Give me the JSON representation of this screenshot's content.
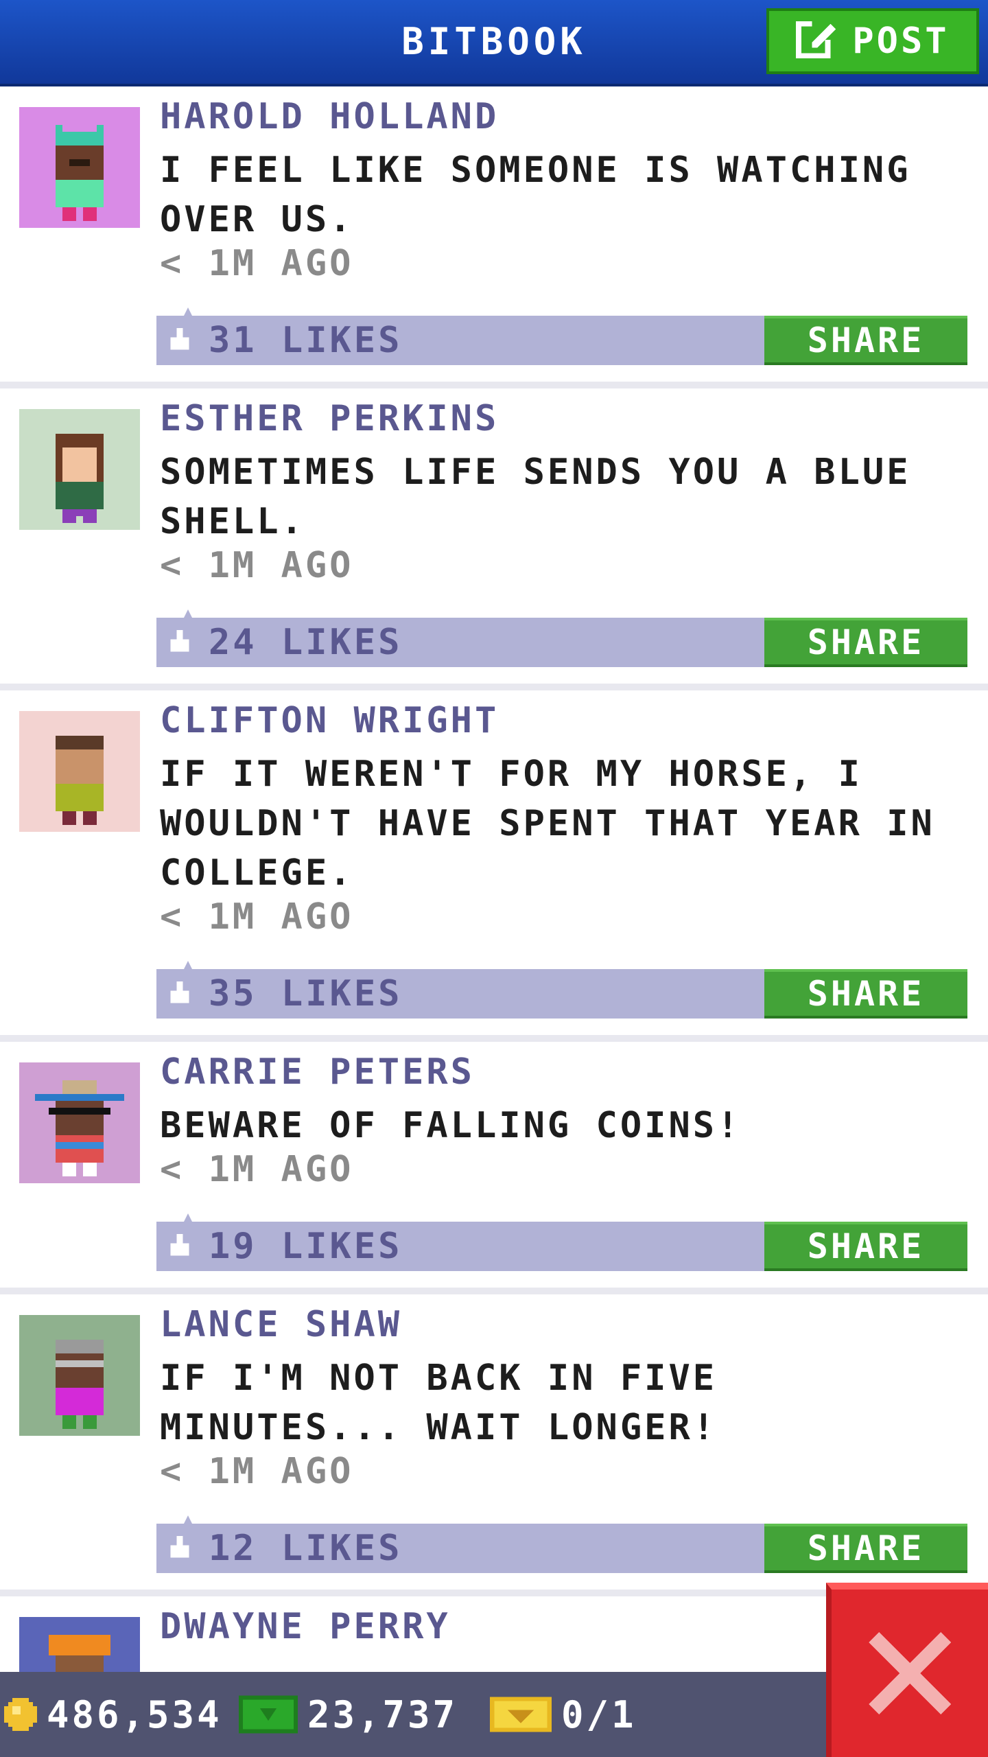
{
  "header": {
    "title": "BITBOOK",
    "post_label": "POST"
  },
  "posts": [
    {
      "name": "HAROLD HOLLAND",
      "text": "I FEEL LIKE SOMEONE IS WATCHING OVER US.",
      "time": "< 1M AGO",
      "likes": "31 LIKES",
      "share": "SHARE",
      "avatar_bg": "#d98be6"
    },
    {
      "name": "ESTHER PERKINS",
      "text": "SOMETIMES LIFE SENDS YOU A BLUE SHELL.",
      "time": "< 1M AGO",
      "likes": "24 LIKES",
      "share": "SHARE",
      "avatar_bg": "#c9dec7"
    },
    {
      "name": "CLIFTON WRIGHT",
      "text": "IF IT WEREN'T FOR MY HORSE, I WOULDN'T HAVE SPENT THAT YEAR IN COLLEGE.",
      "time": "< 1M AGO",
      "likes": "35 LIKES",
      "share": "SHARE",
      "avatar_bg": "#f3d3d1"
    },
    {
      "name": "CARRIE PETERS",
      "text": "BEWARE OF FALLING COINS!",
      "time": "< 1M AGO",
      "likes": "19 LIKES",
      "share": "SHARE",
      "avatar_bg": "#cf9fd3"
    },
    {
      "name": "LANCE SHAW",
      "text": "IF I'M NOT BACK IN FIVE MINUTES... WAIT LONGER!",
      "time": "< 1M AGO",
      "likes": "12 LIKES",
      "share": "SHARE",
      "avatar_bg": "#8fb18e"
    },
    {
      "name": "DWAYNE PERRY",
      "text": "",
      "time": "",
      "likes": "",
      "share": "",
      "avatar_bg": "#5a65b8"
    }
  ],
  "status": {
    "coins": "486,534",
    "bux": "23,737",
    "tickets": "0/1"
  },
  "colors": {
    "header": "#1d55c8",
    "accent_green": "#43a338",
    "likes_bar": "#b1b2d6",
    "close_red": "#e0272d"
  },
  "icons": {
    "post": "compose-icon",
    "like": "thumb-icon",
    "coin": "coin-icon",
    "bux": "bux-icon",
    "ticket": "ticket-icon",
    "close": "close-icon"
  }
}
